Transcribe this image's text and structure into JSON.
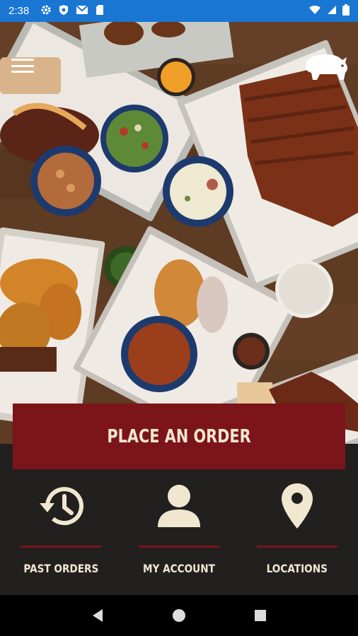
{
  "status_bar": {
    "time": "2:38",
    "icons_left": [
      "gear-icon",
      "shield-icon",
      "gmail-icon",
      "sd-card-icon"
    ],
    "icons_right": [
      "wifi-icon",
      "signal-icon",
      "battery-icon"
    ]
  },
  "hero": {
    "menu_icon": "hamburger-menu-icon",
    "logo": "pig-logo"
  },
  "order_button": {
    "label": "PLACE AN ORDER"
  },
  "nav": [
    {
      "icon": "history-clock-icon",
      "label": "PAST ORDERS"
    },
    {
      "icon": "user-icon",
      "label": "MY ACCOUNT"
    },
    {
      "icon": "location-pin-icon",
      "label": "LOCATIONS"
    }
  ],
  "colors": {
    "status_bar": "#1976d2",
    "accent_red": "#7c1519",
    "panel_dark": "#221f1f",
    "cream_text": "#f1e7d0"
  },
  "android_nav": [
    "back-button",
    "home-button",
    "recents-button"
  ]
}
